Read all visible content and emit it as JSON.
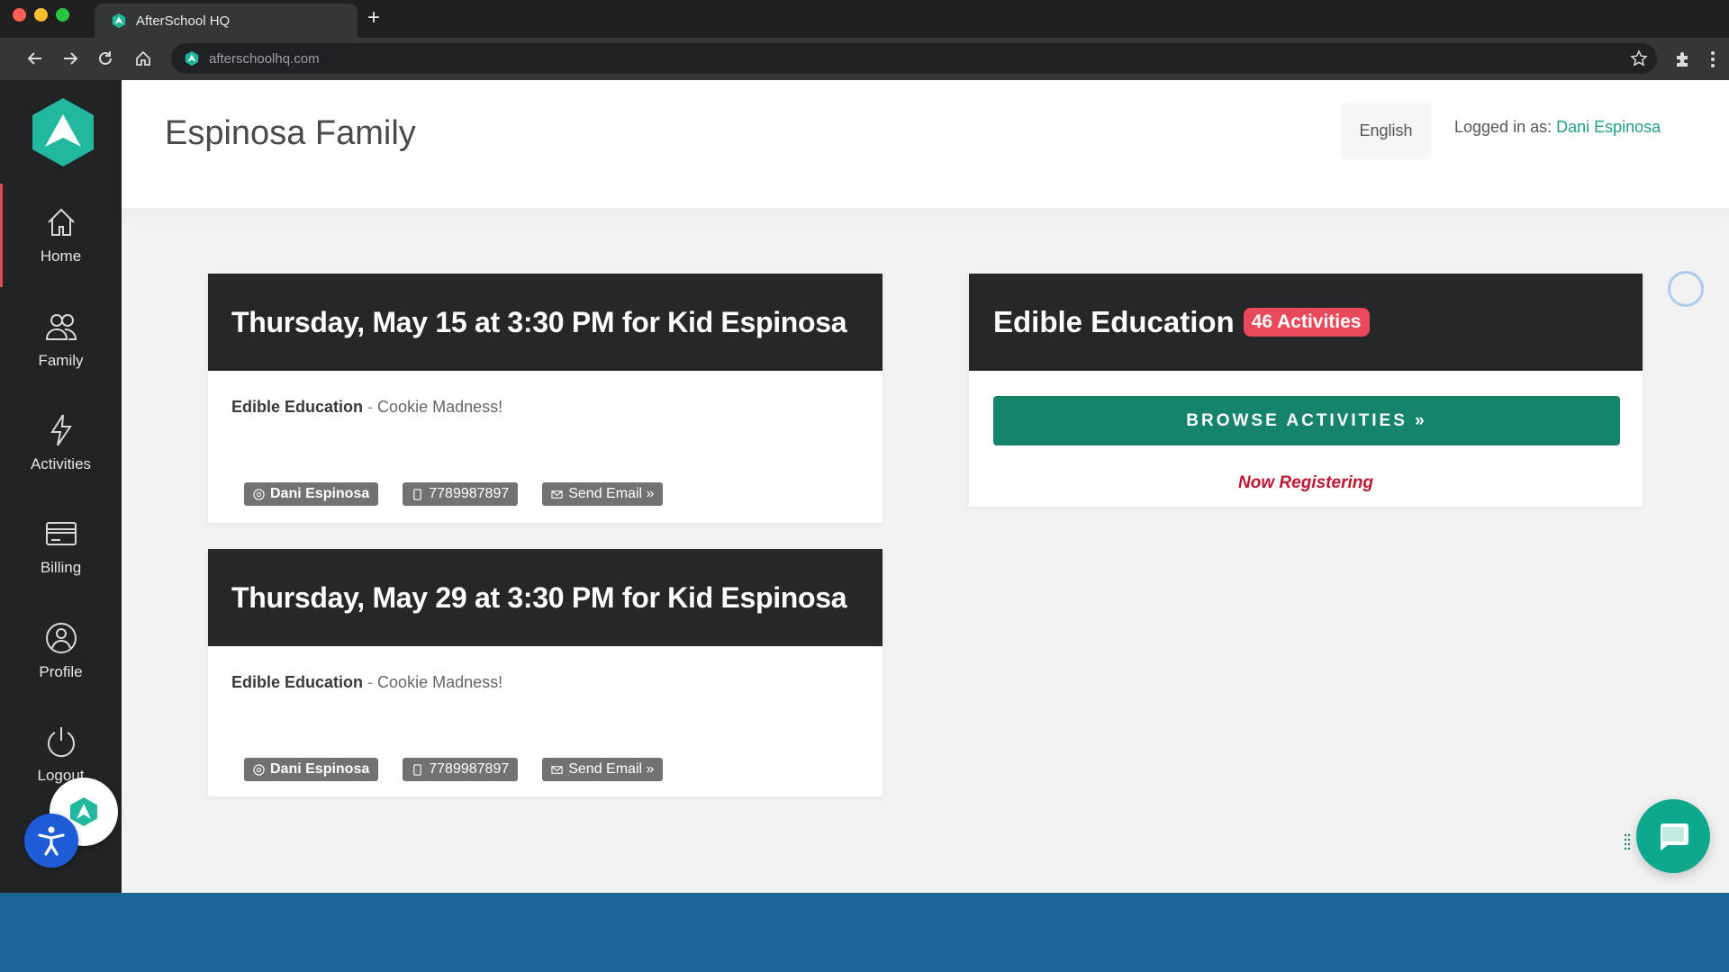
{
  "browser": {
    "tab_title": "AfterSchool HQ",
    "url": "afterschoolhq.com"
  },
  "sidebar": {
    "items": [
      {
        "label": "Home",
        "icon": "home-icon"
      },
      {
        "label": "Family",
        "icon": "family-icon"
      },
      {
        "label": "Activities",
        "icon": "lightning-icon"
      },
      {
        "label": "Billing",
        "icon": "billing-icon"
      },
      {
        "label": "Profile",
        "icon": "profile-icon"
      },
      {
        "label": "Logout",
        "icon": "power-icon"
      }
    ]
  },
  "header": {
    "title": "Espinosa Family",
    "language": "English",
    "logged_in_prefix": "Logged in as:",
    "user_name": "Dani Espinosa"
  },
  "sessions": [
    {
      "title": "Thursday, May 15 at 3:30 PM for Kid Espinosa",
      "program": "Edible Education",
      "separator": "-",
      "activity": "Cookie Madness!",
      "contact_name": "Dani Espinosa",
      "phone": "7789987897",
      "email_label": "Send Email »"
    },
    {
      "title": "Thursday, May 29 at 3:30 PM for Kid Espinosa",
      "program": "Edible Education",
      "separator": "-",
      "activity": "Cookie Madness!",
      "contact_name": "Dani Espinosa",
      "phone": "7789987897",
      "email_label": "Send Email »"
    }
  ],
  "provider": {
    "name": "Edible Education",
    "badge": "46 Activities",
    "browse_label": "BROWSE ACTIVITIES »",
    "status": "Now Registering"
  },
  "colors": {
    "accent": "#16836c",
    "badge": "#e9495a",
    "status": "#c0172f",
    "sidebar": "#222325"
  }
}
